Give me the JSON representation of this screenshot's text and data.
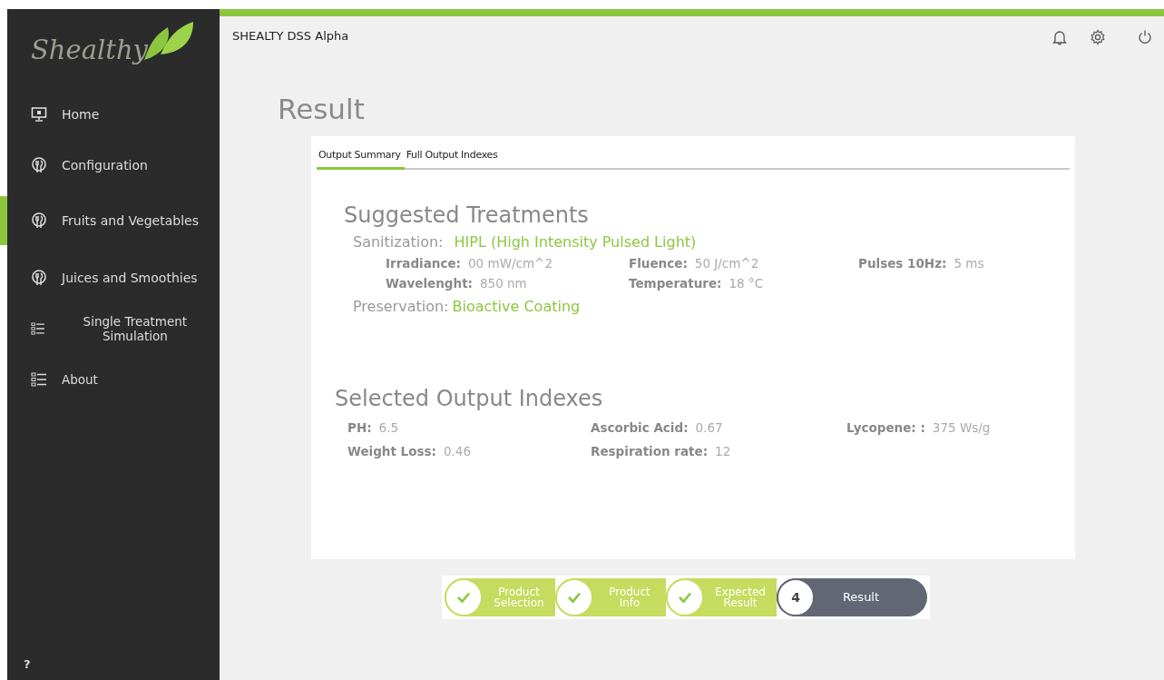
{
  "sidebar": {
    "logo": "Shealthy",
    "items": [
      {
        "label": "Home",
        "kind": "monitor",
        "selected": false
      },
      {
        "label": "Configuration",
        "kind": "cutlery",
        "selected": false
      },
      {
        "label": "Fruits and Vegetables",
        "kind": "cutlery",
        "selected": true
      },
      {
        "label": "Juices and Smoothies",
        "kind": "cutlery",
        "selected": false
      },
      {
        "label": "Single Treatment Simulation",
        "kind": "list",
        "selected": false
      },
      {
        "label": "About",
        "kind": "list",
        "selected": false
      }
    ],
    "help": "?"
  },
  "header": {
    "title": "SHEALTY DSS Alpha"
  },
  "page_title": "Result",
  "tabs": [
    {
      "label": "Output Summary",
      "selected": true
    },
    {
      "label": "Full Output Indexes",
      "selected": false
    }
  ],
  "suggested": {
    "heading": "Suggested Treatments",
    "sanitization": {
      "label": "Sanitization:",
      "value": "HIPL (High Intensity Pulsed Light)"
    },
    "params": [
      {
        "label": "Irradiance:",
        "value": "00 mW/cm^2"
      },
      {
        "label": "Fluence:",
        "value": "50 J/cm^2"
      },
      {
        "label": "Pulses 10Hz:",
        "value": "5 ms"
      },
      {
        "label": "Wavelenght:",
        "value": "850 nm"
      },
      {
        "label": "Temperature:",
        "value": "18 °C"
      }
    ],
    "preservation": {
      "label": "Preservation:",
      "value": "Bioactive Coating"
    }
  },
  "indexes": {
    "heading": "Selected Output Indexes",
    "items": [
      {
        "label": "PH:",
        "value": "6.5"
      },
      {
        "label": "Ascorbic Acid:",
        "value": "0.67"
      },
      {
        "label": "Lycopene: :",
        "value": "375 Ws/g"
      },
      {
        "label": "Weight Loss:",
        "value": "0.46"
      },
      {
        "label": "Respiration rate:",
        "value": "12"
      }
    ]
  },
  "steps": [
    {
      "label": "Product Selection",
      "kind": "done"
    },
    {
      "label": "Product Info",
      "kind": "done"
    },
    {
      "label": "Expected Result",
      "kind": "done"
    },
    {
      "label": "Result",
      "kind": "current",
      "number": "4"
    }
  ]
}
